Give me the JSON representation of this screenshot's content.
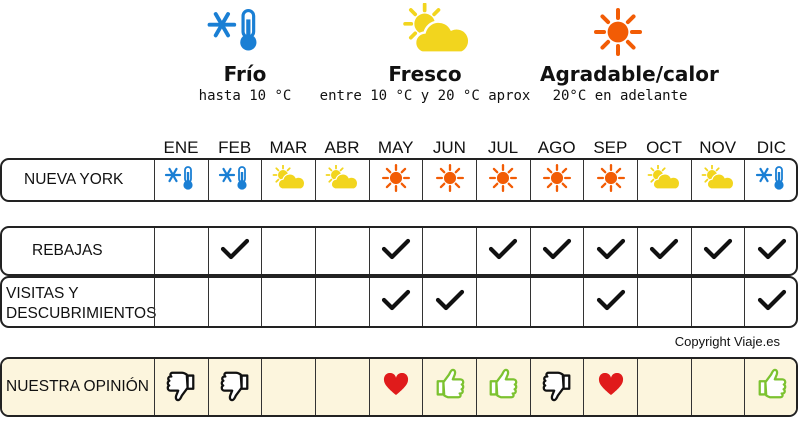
{
  "legend": [
    {
      "title": "Frío",
      "subtitle": "hasta 10 °C",
      "icon": "snowflake-thermometer-icon"
    },
    {
      "title": "Fresco",
      "subtitle": "entre 10 °C y 20 °C aprox",
      "icon": "sun-cloud-icon"
    },
    {
      "title": "Agradable/calor",
      "subtitle": "20°C en adelante",
      "icon": "sun-icon"
    }
  ],
  "months": [
    "ENE",
    "FEB",
    "MAR",
    "ABR",
    "MAY",
    "JUN",
    "JUL",
    "AGO",
    "SEP",
    "OCT",
    "NOV",
    "DIC"
  ],
  "weather_row": {
    "label": "NUEVA YORK",
    "values": [
      "cold",
      "cold",
      "cool",
      "cool",
      "warm",
      "warm",
      "warm",
      "warm",
      "warm",
      "cool",
      "cool",
      "cold"
    ]
  },
  "sales_row": {
    "label": "REBAJAS",
    "values": [
      false,
      true,
      false,
      false,
      true,
      false,
      true,
      true,
      true,
      true,
      true,
      true
    ]
  },
  "visits_row": {
    "label_line1": "VISITAS Y",
    "label_line2": "DESCUBRIMIENTOS",
    "values": [
      false,
      false,
      false,
      false,
      true,
      true,
      false,
      false,
      true,
      false,
      false,
      true
    ]
  },
  "opinion_row": {
    "label": "NUESTRA OPINIÓN",
    "values": [
      "down",
      "down",
      "",
      "",
      "heart",
      "up",
      "up",
      "down",
      "heart",
      "",
      "",
      "up"
    ]
  },
  "copyright": "Copyright Viaje.es",
  "colors": {
    "cold_blue": "#1a7fd4",
    "cool_yellow": "#f2d51e",
    "warm_orange": "#f25c05",
    "opinion_bg": "#fcf5dd",
    "heart_red": "#e01b1b",
    "thumb_green": "#7cc230"
  }
}
